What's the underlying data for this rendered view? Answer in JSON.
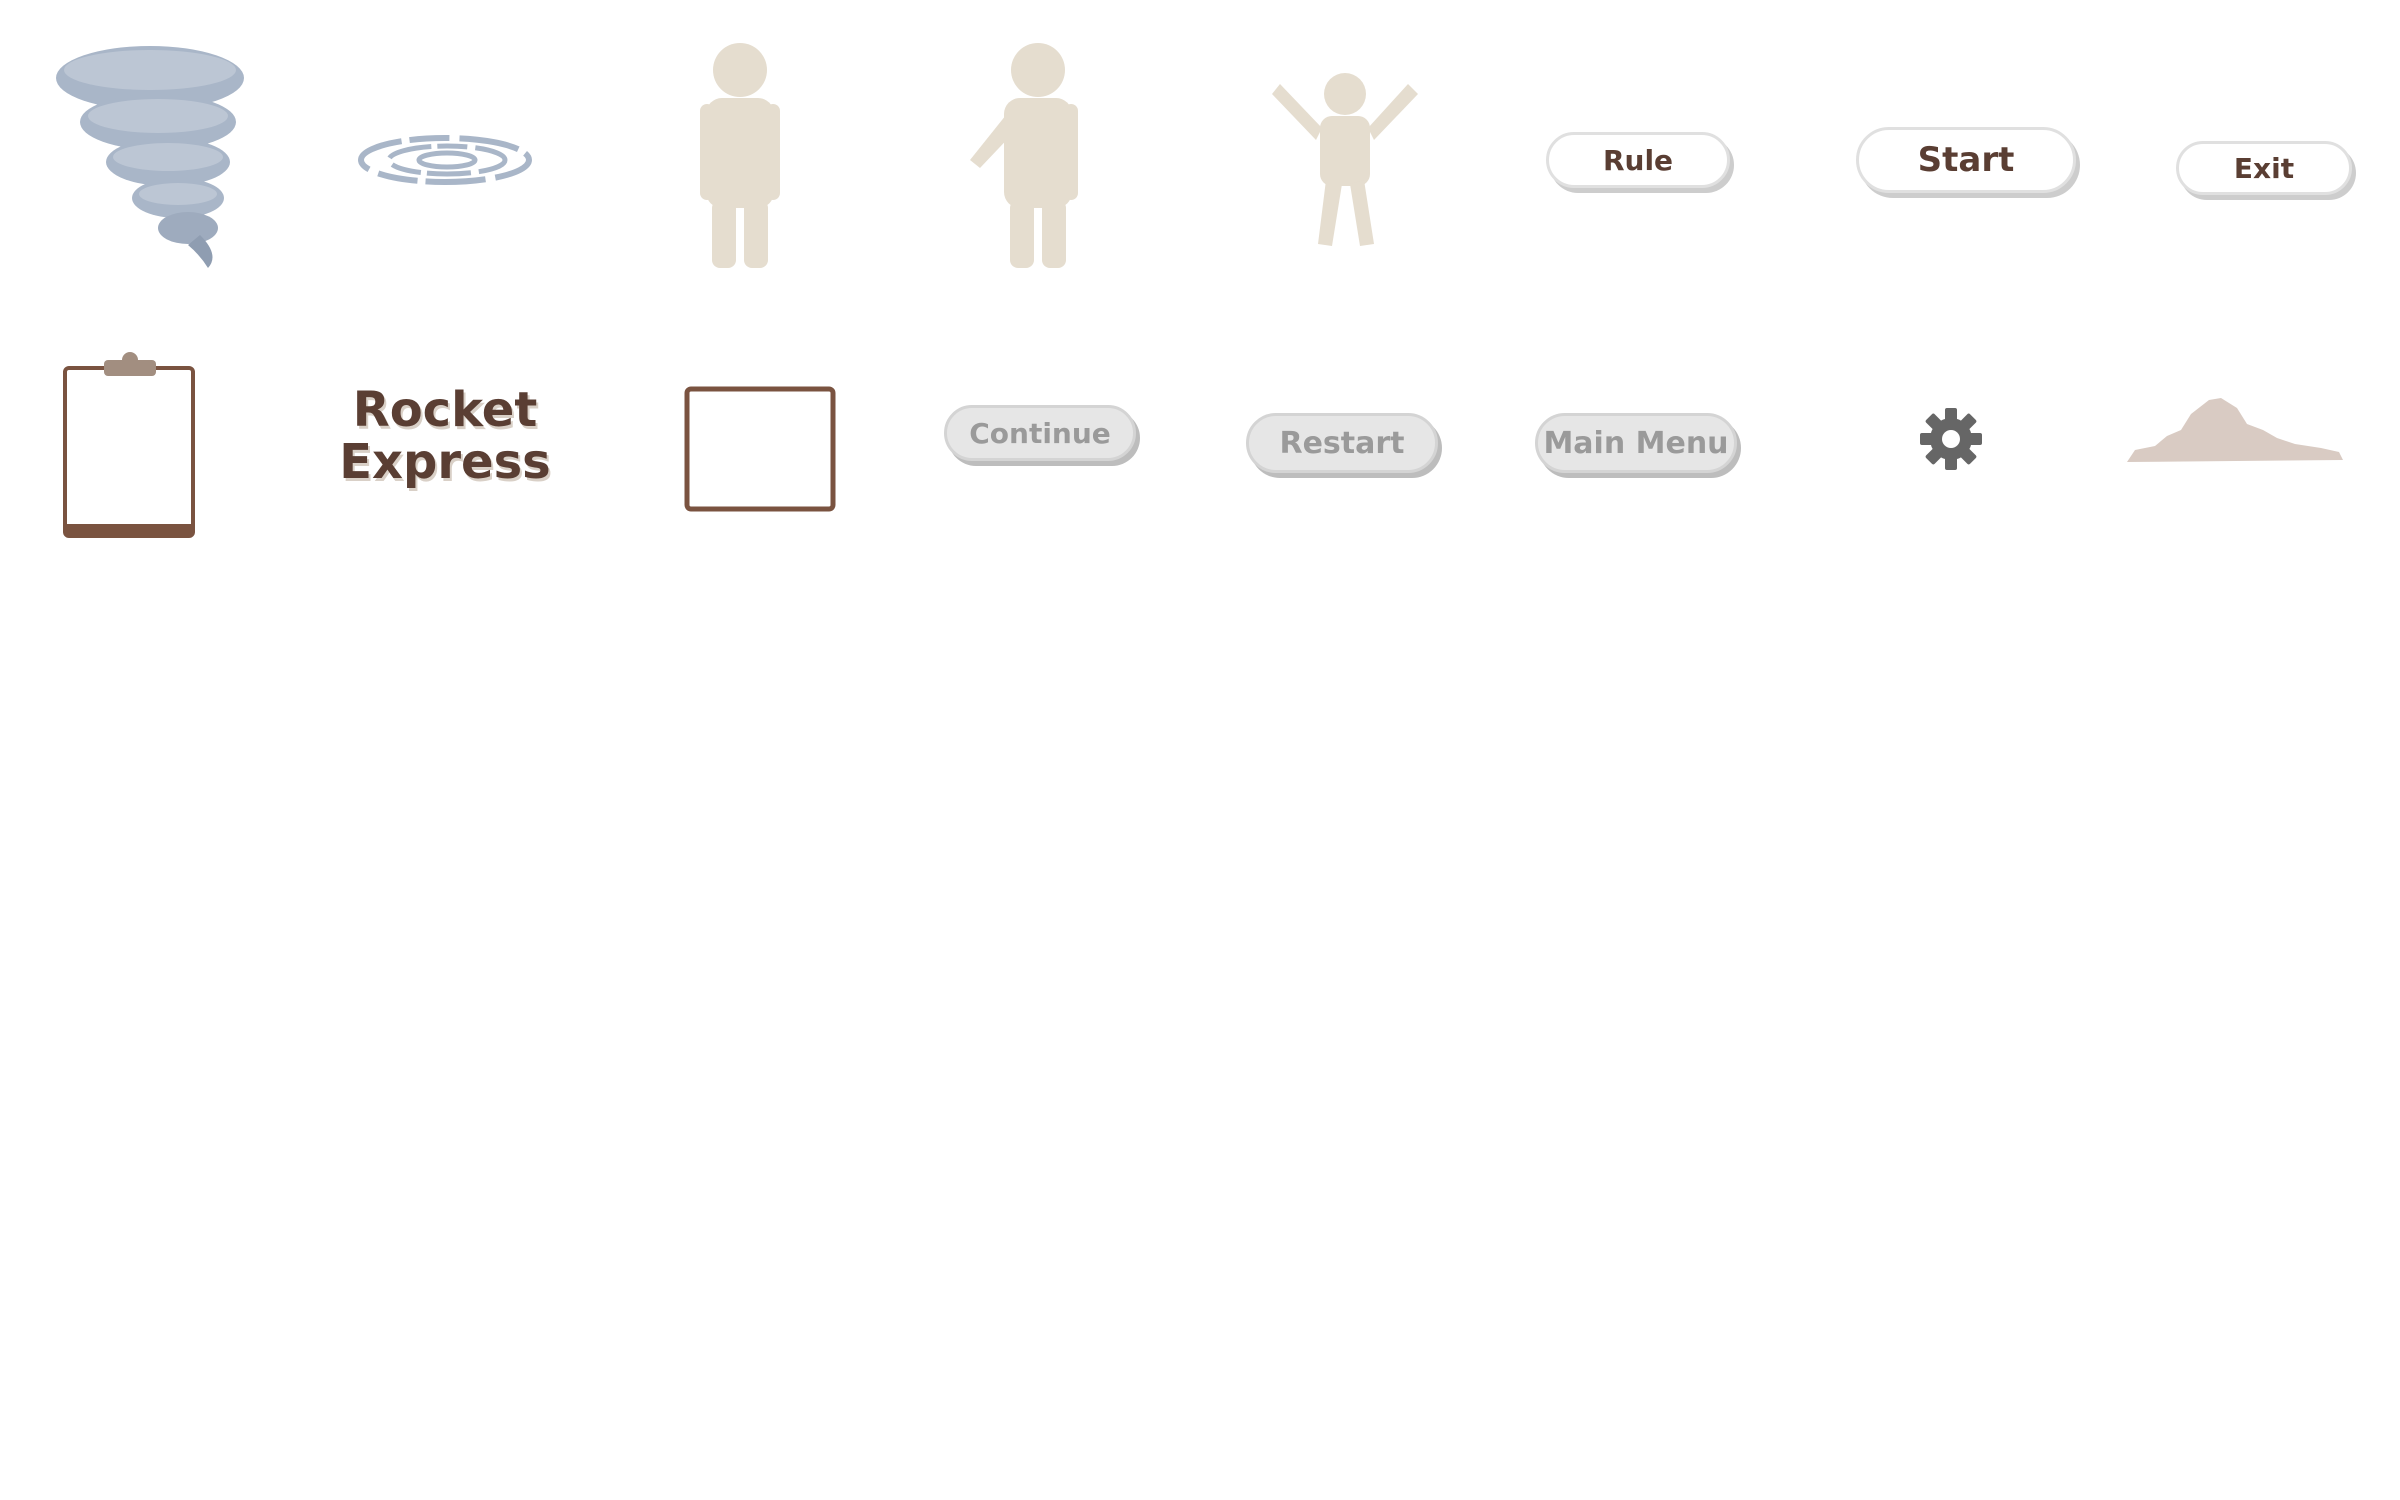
{
  "colors": {
    "tornado": "#a9b6c8",
    "tornado_dark": "#8f9db1",
    "figure": "#e5ddcf",
    "brown": "#7a5340",
    "text_brown": "#5a3e33",
    "button_white": "#ffffff",
    "button_grey": "#e6e6e6",
    "gear": "#666666",
    "dust": "#d9cbc3"
  },
  "sprites": {
    "tornado": "tornado-icon",
    "swirl": "swirl-icon",
    "figure_standing": "person-standing-icon",
    "figure_pointing": "person-pointing-icon",
    "figure_cheering": "person-cheering-icon",
    "clipboard": "clipboard-icon",
    "frame": "frame-icon",
    "gear": "gear-icon",
    "dust_cloud": "dust-cloud-icon"
  },
  "buttons": {
    "rule": "Rule",
    "start": "Start",
    "exit": "Exit",
    "continue": "Continue",
    "restart": "Restart",
    "main_menu": "Main Menu"
  },
  "title": {
    "line1": "Rocket",
    "line2": "Express"
  }
}
